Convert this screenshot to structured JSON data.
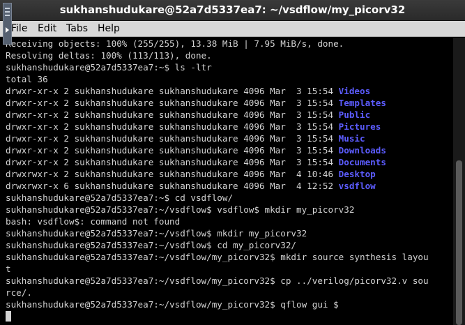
{
  "window": {
    "title": "sukhanshudukare@52a7d5337ea7: ~/vsdflow/my_picorv32"
  },
  "menu": {
    "items": [
      "File",
      "Edit",
      "Tabs",
      "Help"
    ]
  },
  "terminal": {
    "lines": [
      {
        "text": "Receiving objects: 100% (255/255), 13.38 MiB | 7.95 MiB/s, done."
      },
      {
        "text": "Resolving deltas: 100% (113/113), done."
      },
      {
        "text": "sukhanshudukare@52a7d5337ea7:~$ ls -ltr"
      },
      {
        "text": "total 36"
      },
      {
        "text": "drwxr-xr-x 2 sukhanshudukare sukhanshudukare 4096 Mar  3 15:54 ",
        "dir": "Videos"
      },
      {
        "text": "drwxr-xr-x 2 sukhanshudukare sukhanshudukare 4096 Mar  3 15:54 ",
        "dir": "Templates"
      },
      {
        "text": "drwxr-xr-x 2 sukhanshudukare sukhanshudukare 4096 Mar  3 15:54 ",
        "dir": "Public"
      },
      {
        "text": "drwxr-xr-x 2 sukhanshudukare sukhanshudukare 4096 Mar  3 15:54 ",
        "dir": "Pictures"
      },
      {
        "text": "drwxr-xr-x 2 sukhanshudukare sukhanshudukare 4096 Mar  3 15:54 ",
        "dir": "Music"
      },
      {
        "text": "drwxr-xr-x 2 sukhanshudukare sukhanshudukare 4096 Mar  3 15:54 ",
        "dir": "Downloads"
      },
      {
        "text": "drwxr-xr-x 2 sukhanshudukare sukhanshudukare 4096 Mar  3 15:54 ",
        "dir": "Documents"
      },
      {
        "text": "drwxrwxr-x 2 sukhanshudukare sukhanshudukare 4096 Mar  4 10:46 ",
        "dir": "Desktop"
      },
      {
        "text": "drwxrwxr-x 6 sukhanshudukare sukhanshudukare 4096 Mar  4 12:52 ",
        "dir": "vsdflow"
      },
      {
        "text": "sukhanshudukare@52a7d5337ea7:~$ cd vsdflow/"
      },
      {
        "text": "sukhanshudukare@52a7d5337ea7:~/vsdflow$ vsdflow$ mkdir my_picorv32"
      },
      {
        "text": "bash: vsdflow$: command not found"
      },
      {
        "text": "sukhanshudukare@52a7d5337ea7:~/vsdflow$ mkdir my_picorv32"
      },
      {
        "text": "sukhanshudukare@52a7d5337ea7:~/vsdflow$ cd my_picorv32/"
      },
      {
        "text": "sukhanshudukare@52a7d5337ea7:~/vsdflow/my_picorv32$ mkdir source synthesis layou"
      },
      {
        "text": "t"
      },
      {
        "text": "sukhanshudukare@52a7d5337ea7:~/vsdflow/my_picorv32$ cp ../verilog/picorv32.v sou"
      },
      {
        "text": "rce/."
      },
      {
        "text": "sukhanshudukare@52a7d5337ea7:~/vsdflow/my_picorv32$ qflow gui $"
      }
    ]
  },
  "colors": {
    "background": "#000000",
    "foreground": "#d3d3d3",
    "directory": "#5c5cff",
    "titlebar": "#2f2f2f",
    "menubar": "#d8d8d8"
  }
}
